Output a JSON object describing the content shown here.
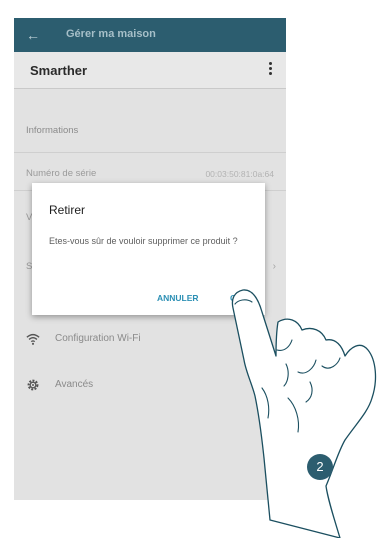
{
  "appbar": {
    "back_icon": "←",
    "title": "Gérer ma maison"
  },
  "device": {
    "name": "Smarther",
    "menu_icon": "kebab-menu-icon"
  },
  "info": {
    "section_label": "Informations",
    "serial_label": "Numéro de série",
    "serial_value": "00:03:50:81:0a:64",
    "partial_row_1": "V",
    "partial_row_2": "S"
  },
  "menu": {
    "items": [
      {
        "label": "Configuration Wi-Fi",
        "icon": "wifi-icon"
      },
      {
        "label": "Avancés",
        "icon": "gear-icon"
      }
    ]
  },
  "dialog": {
    "title": "Retirer",
    "message": "Etes-vous sûr de vouloir supprimer ce produit ?",
    "cancel_label": "ANNULER",
    "ok_label": "OK"
  },
  "step": {
    "number": "2"
  },
  "colors": {
    "appbar": "#2c5d6f",
    "accent": "#2b8fb4",
    "background": "#e2e2e2"
  }
}
